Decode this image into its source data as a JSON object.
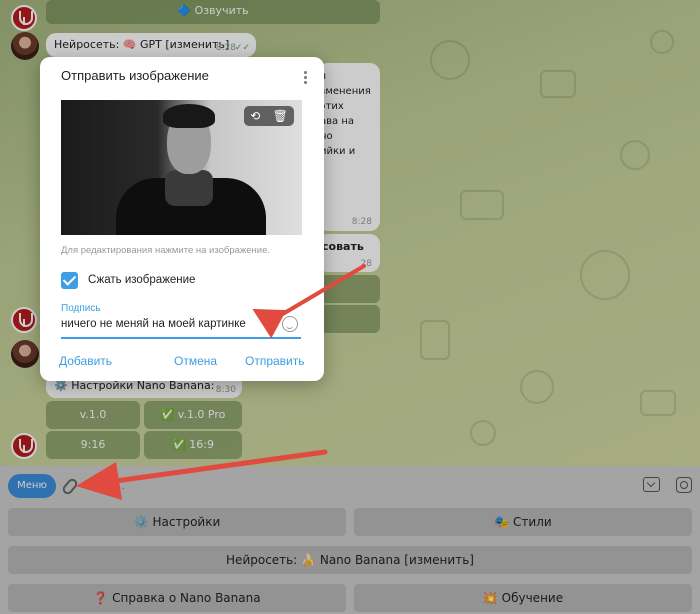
{
  "chat": {
    "voice_button": "🔷 Озвучить",
    "model_message": "Нейросеть: 🧠 GPT [изменить]",
    "model_message_time": "8:28",
    "right_bubble_lines": [
      "",
      "",
      "я",
      "зменения этих",
      "ава на",
      "",
      "",
      "но",
      "ийки и",
      ""
    ],
    "right_bubble_time": "8:28",
    "right_bubble2_text": "совать",
    "right_bubble2_time": "28",
    "settings_message": "⚙️ Настройки Nano Banana:",
    "settings_message_label": "Настройки Nano Banana",
    "settings_message_time": "8:30",
    "inline_buttons": [
      {
        "label": "v.1.0"
      },
      {
        "label": "✅ v.1.0 Pro"
      },
      {
        "label": "9:16"
      },
      {
        "label": "✅ 16:9"
      }
    ]
  },
  "modal": {
    "title": "Отправить изображение",
    "hint": "Для редактирования нажмите на изображение.",
    "compress_label": "Сжать изображение",
    "caption_label": "Подпись",
    "caption_value": "ничего не меняй на моей картинке",
    "actions": {
      "add": "Добавить",
      "cancel": "Отмена",
      "send": "Отправить"
    },
    "tools": {
      "replace": "⟲",
      "delete": "🗑"
    }
  },
  "composer": {
    "menu_label": "Меню",
    "placeholder": "...ие..."
  },
  "keyboard": {
    "settings": "⚙️ Настройки",
    "styles": "🎭 Стили",
    "model": "Нейросеть: 🍌 Nano Banana [изменить]",
    "help": "❓ Справка о Nano Banana",
    "learning": "💥 Обучение"
  },
  "colors": {
    "accent": "#3d9ee3",
    "arrow": "#e04a3f"
  }
}
